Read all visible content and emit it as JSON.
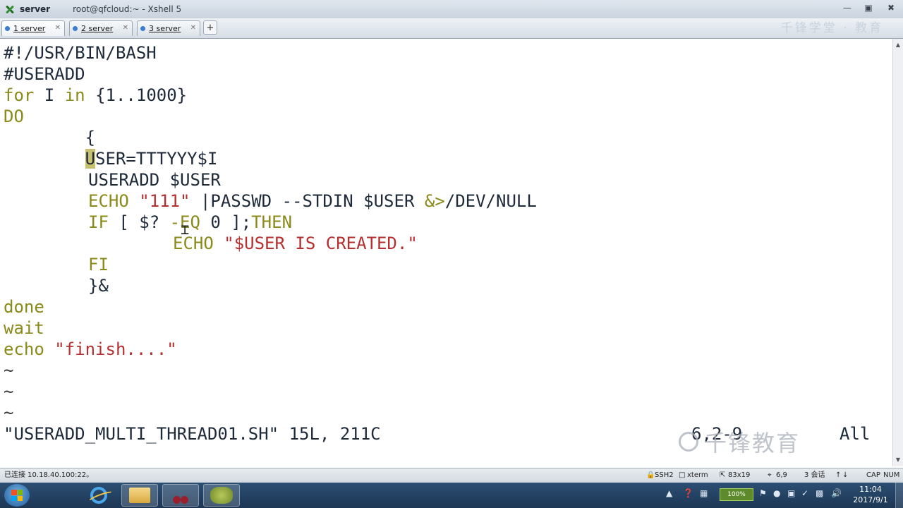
{
  "window": {
    "session_name": "server",
    "title": "root@qfcloud:~ - Xshell 5"
  },
  "tabs": [
    {
      "label": "1 server",
      "active": true
    },
    {
      "label": "2 server",
      "active": false
    },
    {
      "label": "3 server",
      "active": false
    }
  ],
  "watermark_top": "千锋学堂 · 教育",
  "colors": {
    "keyword": "#8a8a1a",
    "string": "#b52f2f",
    "text": "#1e2a3a",
    "cursor_highlight": "#c6c070"
  },
  "editor": {
    "lines": {
      "l1": "#!/USR/BIN/BASH",
      "l2": "#USERADD",
      "l3_kw1": "for",
      "l3_mid": " I ",
      "l3_kw2": "in",
      "l3_end": " {1..1000}",
      "l4": "DO",
      "l5": "        {",
      "l6_indent": "        ",
      "l6_cursor": "U",
      "l6_rest": "SER=TTTYYY$I",
      "l7_kw": "USERADD",
      "l7_rest": " $USER",
      "l8_kw": "ECHO",
      "l8_str": " \"111\" ",
      "l8_mid": "|PASSWD --STDIN $USER ",
      "l8_kw2": "&>",
      "l8_end": "/DEV/NULL",
      "l9_kw": "IF",
      "l9_mid": " [ $? ",
      "l9_kw2": "-EQ",
      "l9_mid2": " 0 ];",
      "l9_kw3": "THEN",
      "l10_kw": "ECHO",
      "l10_str": " \"$USER IS CREATED.\"",
      "l11_kw": "FI",
      "l12": "}&",
      "l13": "done",
      "l14": "wait",
      "l15_kw": "echo",
      "l15_str": " \"finish....\""
    },
    "tildes": [
      "~",
      "~",
      "~"
    ],
    "message": "\"USERADD_MULTI_THREAD01.SH\" 15L, 211C",
    "cursor_pos": "6,2-9",
    "scroll_pos": "All"
  },
  "statusbar": {
    "connection": "已连接 10.18.40.100:22。",
    "protocol": "SSH2",
    "terminal": "xterm",
    "size": "83x19",
    "position": "6,9",
    "sessions": "3 会话",
    "caps": "CAP",
    "num": "NUM"
  },
  "taskbar": {
    "language": "100%",
    "time": "11:04",
    "date": "2017/9/1"
  },
  "brand_watermark": "千锋教育"
}
